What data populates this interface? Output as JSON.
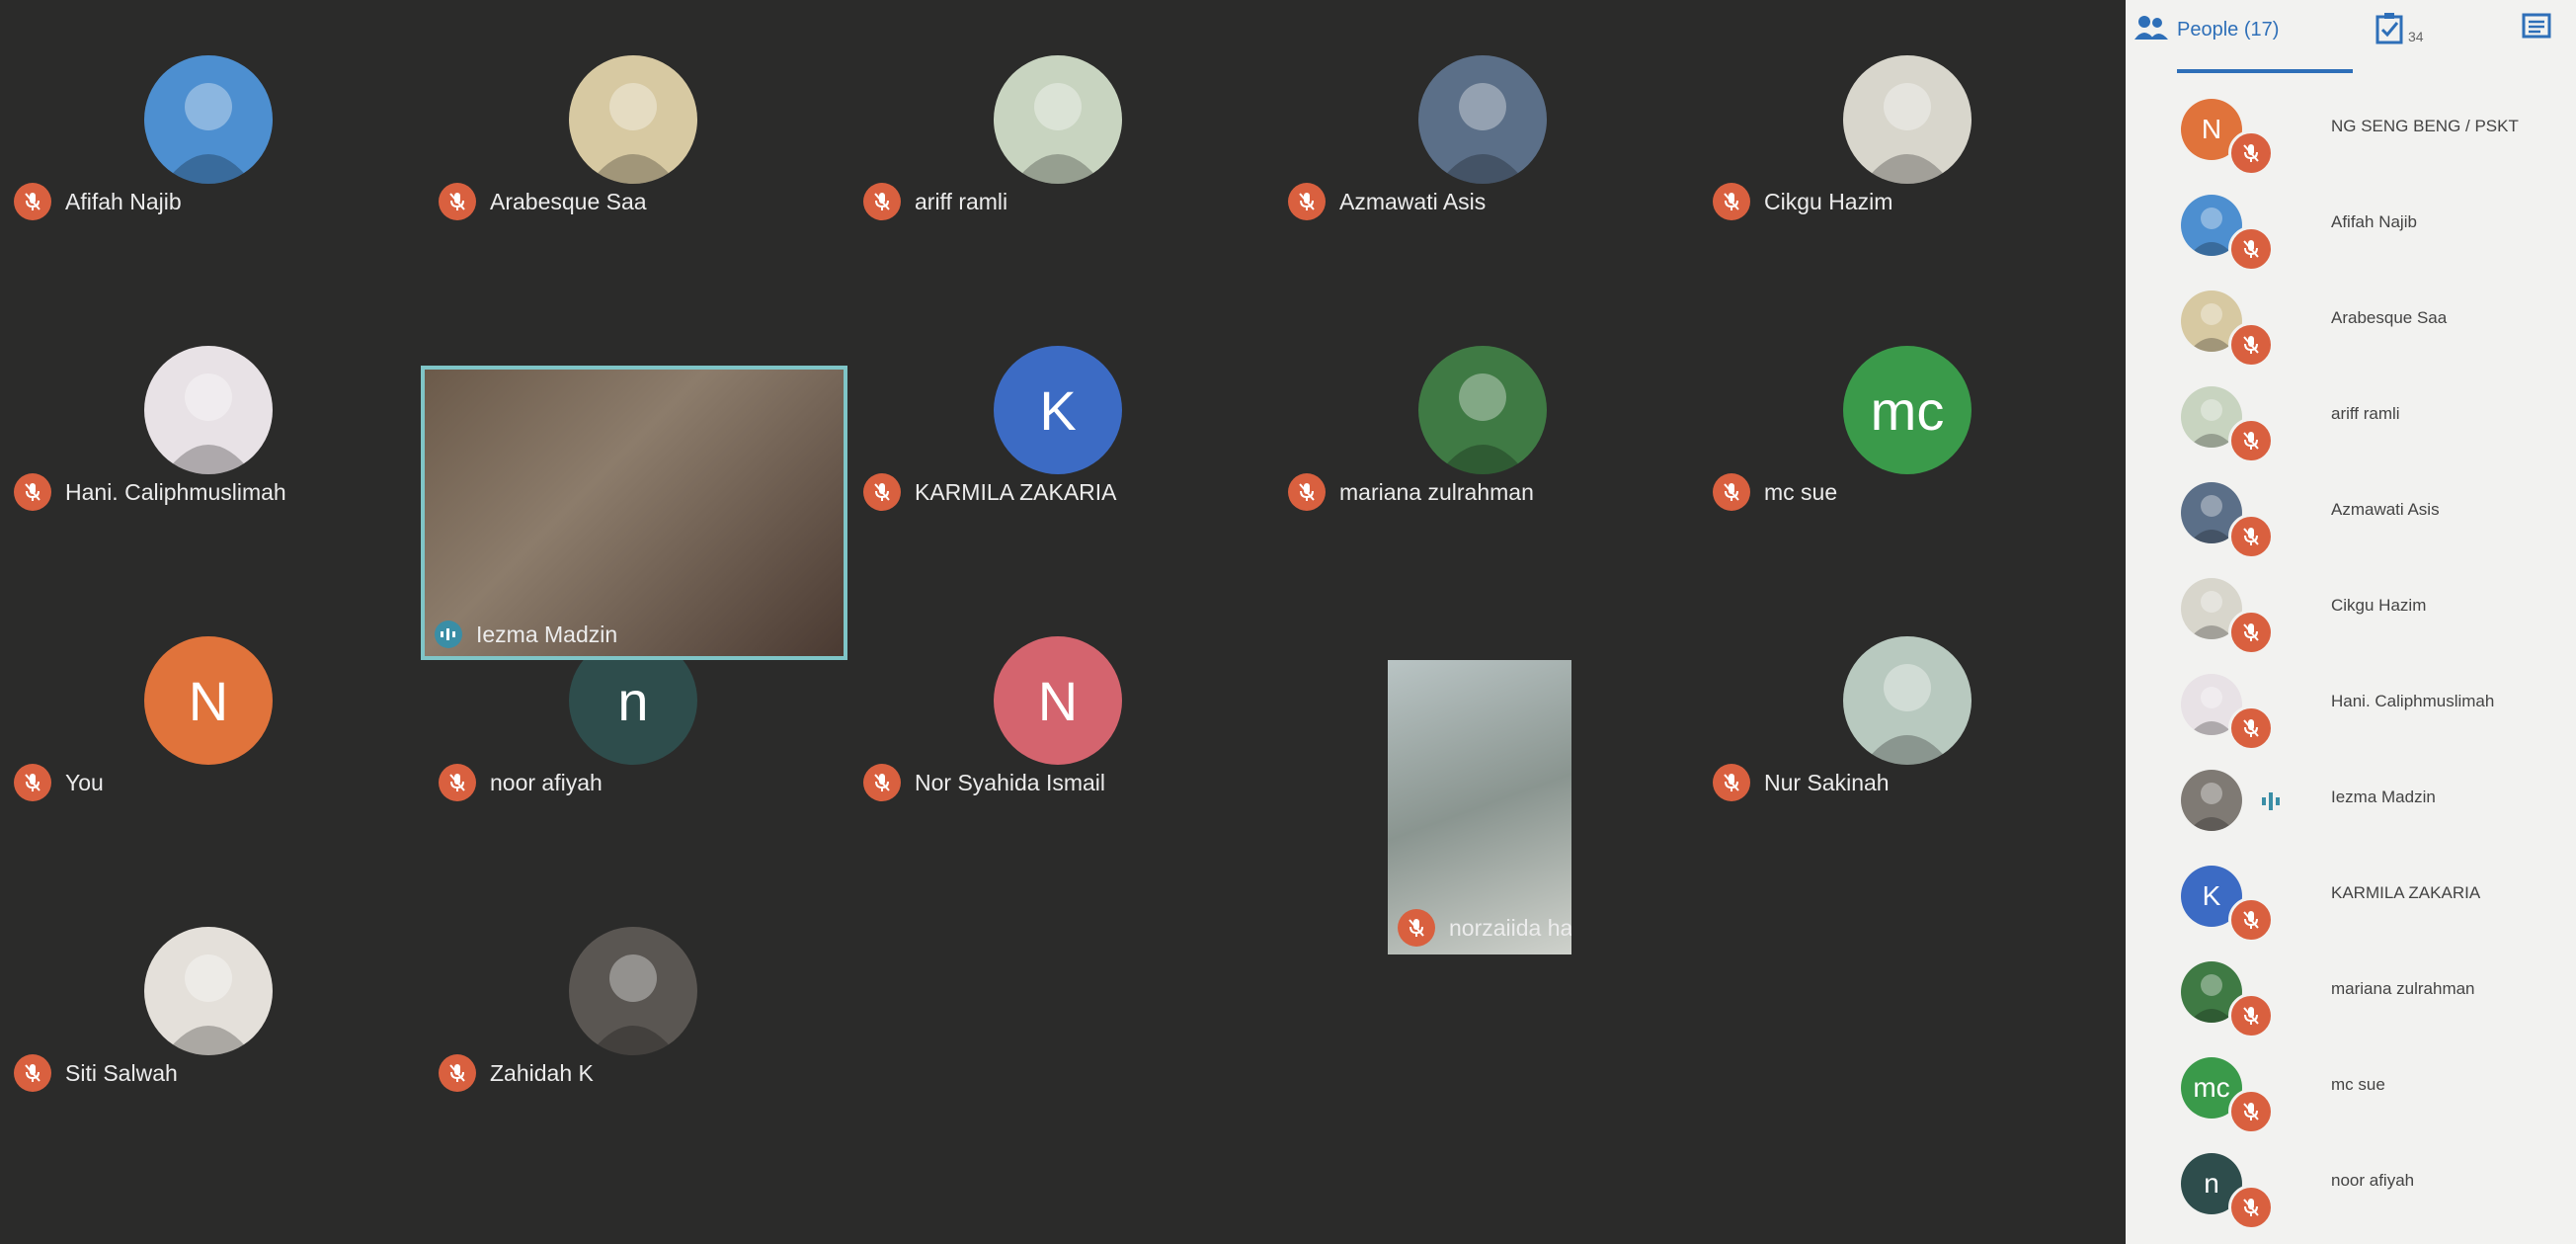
{
  "colors": {
    "stage_bg": "#2b2b2a",
    "mic_muted": "#d9603f",
    "active_outline": "#7fc5c7",
    "panel_bg": "#f2f2f0",
    "accent": "#2e6fb8"
  },
  "grid": {
    "tiles": [
      {
        "name": "Afifah Najib",
        "initials": "",
        "avatar_color": "#4d8fd0"
      },
      {
        "name": "Arabesque Saa",
        "initials": "",
        "avatar_color": "#d7c9a2"
      },
      {
        "name": "ariff ramli",
        "initials": "",
        "avatar_color": "#c8d4c0"
      },
      {
        "name": "Azmawati Asis",
        "initials": "",
        "avatar_color": "#5b6f88"
      },
      {
        "name": "Cikgu Hazim",
        "initials": "",
        "avatar_color": "#d8d6cc"
      },
      {
        "name": "Hani. Caliphmuslimah",
        "initials": "",
        "avatar_color": "#e8e2e6"
      },
      {
        "name": "KARMILA ZAKARIA",
        "initials": "K",
        "avatar_color": "#3c6bc4"
      },
      {
        "name": "mariana zulrahman",
        "initials": "",
        "avatar_color": "#3f7a44"
      },
      {
        "name": "mc sue",
        "initials": "mc",
        "avatar_color": "#3a9a4a"
      },
      {
        "name": "You",
        "initials": "N",
        "avatar_color": "#e0733b"
      },
      {
        "name": "noor afiyah",
        "initials": "n",
        "avatar_color": "#2e4d4c"
      },
      {
        "name": "Nor Syahida Ismail",
        "initials": "N",
        "avatar_color": "#d4646e"
      },
      {
        "name": "Nur Sakinah",
        "initials": "",
        "avatar_color": "#b8c9bf"
      },
      {
        "name": "Siti Salwah",
        "initials": "",
        "avatar_color": "#e4e0da"
      },
      {
        "name": "Zahidah K",
        "initials": "",
        "avatar_color": "#5a5652"
      }
    ],
    "video_tiles": [
      {
        "name": "Iezma Madzin"
      },
      {
        "name": "norzaiida hatun"
      }
    ]
  },
  "panel": {
    "people_label": "People (17)",
    "activities_badge": "34",
    "people": [
      {
        "name": "NG SENG BENG / PSKT",
        "initials": "N",
        "avatar_color": "#e0733b"
      },
      {
        "name": "Afifah Najib",
        "initials": "",
        "avatar_color": "#4d8fd0"
      },
      {
        "name": "Arabesque Saa",
        "initials": "",
        "avatar_color": "#d7c9a2"
      },
      {
        "name": "ariff ramli",
        "initials": "",
        "avatar_color": "#c8d4c0"
      },
      {
        "name": "Azmawati Asis",
        "initials": "",
        "avatar_color": "#5b6f88"
      },
      {
        "name": "Cikgu Hazim",
        "initials": "",
        "avatar_color": "#d8d6cc"
      },
      {
        "name": "Hani. Caliphmuslimah",
        "initials": "",
        "avatar_color": "#e8e2e6"
      },
      {
        "name": "Iezma Madzin",
        "initials": "",
        "avatar_color": "#7f7a74"
      },
      {
        "name": "KARMILA ZAKARIA",
        "initials": "K",
        "avatar_color": "#3c6bc4"
      },
      {
        "name": "mariana zulrahman",
        "initials": "",
        "avatar_color": "#3f7a44"
      },
      {
        "name": "mc sue",
        "initials": "mc",
        "avatar_color": "#3a9a4a"
      },
      {
        "name": "noor afiyah",
        "initials": "n",
        "avatar_color": "#2e4d4c"
      }
    ]
  }
}
